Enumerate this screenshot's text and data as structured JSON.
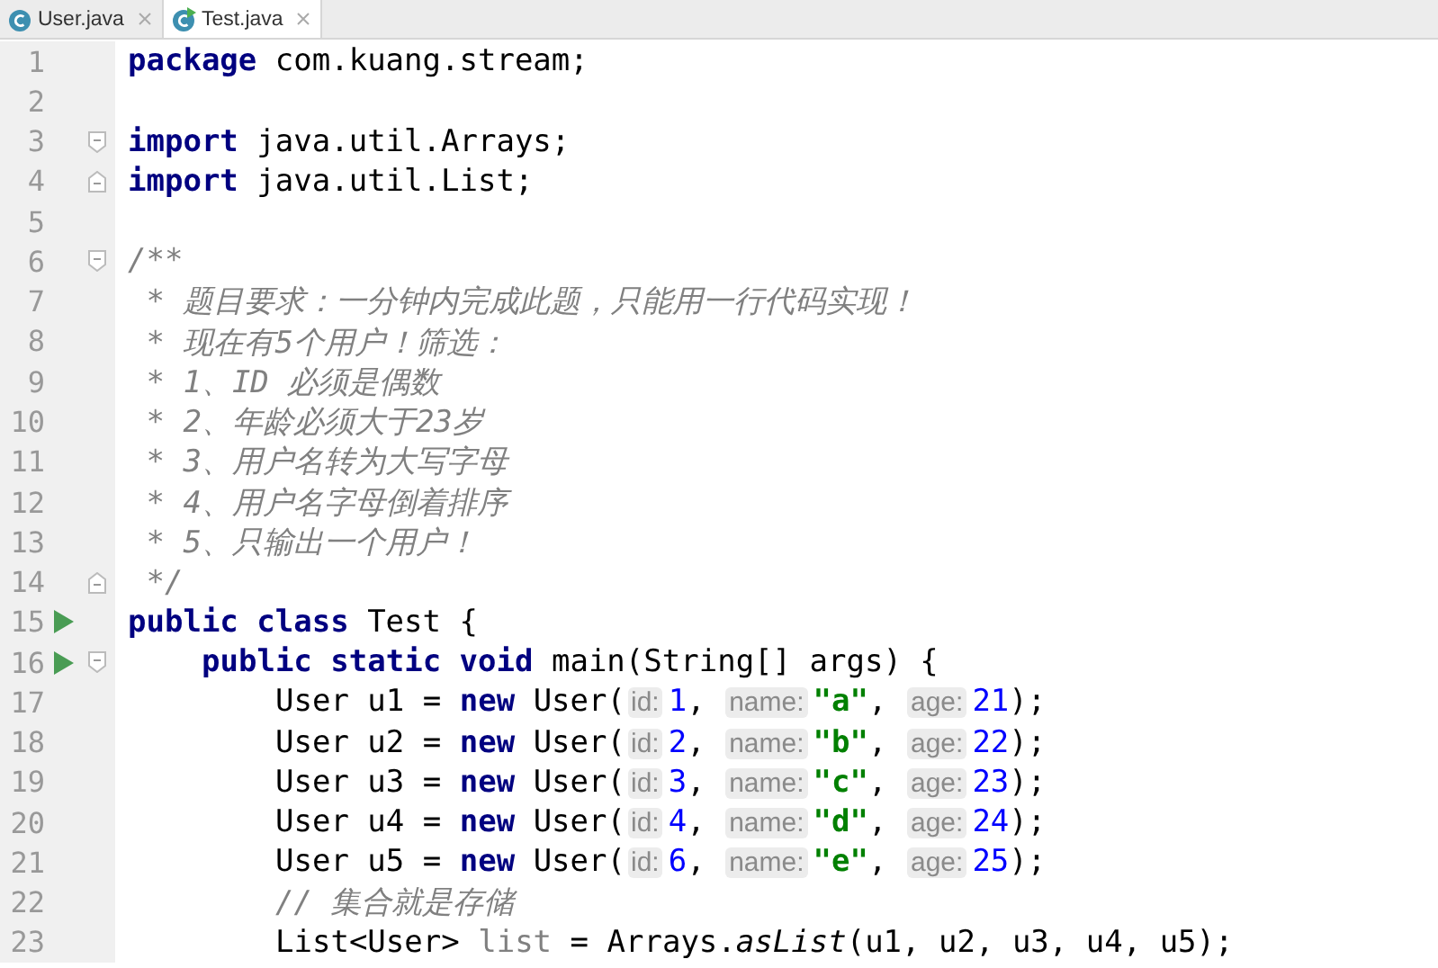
{
  "tabs": [
    {
      "label": "User.java",
      "selected": false,
      "kind": "class"
    },
    {
      "label": "Test.java",
      "selected": true,
      "kind": "runnable"
    }
  ],
  "lines": [
    {
      "number": "1",
      "tokens": [
        {
          "kind": "kw",
          "text": "package"
        },
        {
          "kind": "plain",
          "text": " com.kuang.stream;"
        }
      ]
    },
    {
      "number": "2"
    },
    {
      "number": "3",
      "fold_open": true,
      "tokens": [
        {
          "kind": "kw",
          "text": "import"
        },
        {
          "kind": "plain",
          "text": " java.util.Arrays;"
        }
      ]
    },
    {
      "number": "4",
      "fold_close": true,
      "tokens": [
        {
          "kind": "kw",
          "text": "import"
        },
        {
          "kind": "plain",
          "text": " java.util.List;"
        }
      ]
    },
    {
      "number": "5"
    },
    {
      "number": "6",
      "fold_open": true,
      "tokens": [
        {
          "kind": "comment",
          "text": "/**"
        }
      ]
    },
    {
      "number": "7",
      "tokens": [
        {
          "kind": "comment",
          "text": " * 题目要求：一分钟内完成此题，只能用一行代码实现！"
        }
      ]
    },
    {
      "number": "8",
      "tokens": [
        {
          "kind": "comment",
          "text": " * 现在有5个用户！筛选："
        }
      ]
    },
    {
      "number": "9",
      "tokens": [
        {
          "kind": "comment",
          "text": " * 1、ID 必须是偶数"
        }
      ]
    },
    {
      "number": "10",
      "tokens": [
        {
          "kind": "comment",
          "text": " * 2、年龄必须大于23岁"
        }
      ]
    },
    {
      "number": "11",
      "tokens": [
        {
          "kind": "comment",
          "text": " * 3、用户名转为大写字母"
        }
      ]
    },
    {
      "number": "12",
      "tokens": [
        {
          "kind": "comment",
          "text": " * 4、用户名字母倒着排序"
        }
      ]
    },
    {
      "number": "13",
      "tokens": [
        {
          "kind": "comment",
          "text": " * 5、只输出一个用户！"
        }
      ]
    },
    {
      "number": "14",
      "fold_close": true,
      "tokens": [
        {
          "kind": "comment",
          "text": " */"
        }
      ]
    },
    {
      "number": "15",
      "run": true,
      "tokens": [
        {
          "kind": "kw",
          "text": "public class"
        },
        {
          "kind": "plain",
          "text": " Test {"
        }
      ],
      "children": [
        {
          "number": "16",
          "run": true,
          "fold_open": true,
          "tokens": [
            {
              "kind": "kw",
              "text": "public static void"
            },
            {
              "kind": "plain",
              "text": " main(String[] args) {"
            }
          ],
          "children": [
            {
              "number": "17",
              "tokens": [
                {
                  "kind": "plain",
                  "text": "User u1 = "
                },
                {
                  "kind": "kw",
                  "text": "new"
                },
                {
                  "kind": "plain",
                  "text": " User("
                },
                {
                  "kind": "hint",
                  "text": "id:"
                },
                {
                  "kind": "num",
                  "text": "1"
                },
                {
                  "kind": "plain",
                  "text": ", "
                },
                {
                  "kind": "hint",
                  "text": "name:"
                },
                {
                  "kind": "str",
                  "text": "\"a\""
                },
                {
                  "kind": "plain",
                  "text": ", "
                },
                {
                  "kind": "hint",
                  "text": "age:"
                },
                {
                  "kind": "num",
                  "text": "21"
                },
                {
                  "kind": "plain",
                  "text": ");"
                }
              ]
            },
            {
              "number": "18",
              "tokens": [
                {
                  "kind": "plain",
                  "text": "User u2 = "
                },
                {
                  "kind": "kw",
                  "text": "new"
                },
                {
                  "kind": "plain",
                  "text": " User("
                },
                {
                  "kind": "hint",
                  "text": "id:"
                },
                {
                  "kind": "num",
                  "text": "2"
                },
                {
                  "kind": "plain",
                  "text": ", "
                },
                {
                  "kind": "hint",
                  "text": "name:"
                },
                {
                  "kind": "str",
                  "text": "\"b\""
                },
                {
                  "kind": "plain",
                  "text": ", "
                },
                {
                  "kind": "hint",
                  "text": "age:"
                },
                {
                  "kind": "num",
                  "text": "22"
                },
                {
                  "kind": "plain",
                  "text": ");"
                }
              ]
            },
            {
              "number": "19",
              "tokens": [
                {
                  "kind": "plain",
                  "text": "User u3 = "
                },
                {
                  "kind": "kw",
                  "text": "new"
                },
                {
                  "kind": "plain",
                  "text": " User("
                },
                {
                  "kind": "hint",
                  "text": "id:"
                },
                {
                  "kind": "num",
                  "text": "3"
                },
                {
                  "kind": "plain",
                  "text": ", "
                },
                {
                  "kind": "hint",
                  "text": "name:"
                },
                {
                  "kind": "str",
                  "text": "\"c\""
                },
                {
                  "kind": "plain",
                  "text": ", "
                },
                {
                  "kind": "hint",
                  "text": "age:"
                },
                {
                  "kind": "num",
                  "text": "23"
                },
                {
                  "kind": "plain",
                  "text": ");"
                }
              ]
            },
            {
              "number": "20",
              "tokens": [
                {
                  "kind": "plain",
                  "text": "User u4 = "
                },
                {
                  "kind": "kw",
                  "text": "new"
                },
                {
                  "kind": "plain",
                  "text": " User("
                },
                {
                  "kind": "hint",
                  "text": "id:"
                },
                {
                  "kind": "num",
                  "text": "4"
                },
                {
                  "kind": "plain",
                  "text": ", "
                },
                {
                  "kind": "hint",
                  "text": "name:"
                },
                {
                  "kind": "str",
                  "text": "\"d\""
                },
                {
                  "kind": "plain",
                  "text": ", "
                },
                {
                  "kind": "hint",
                  "text": "age:"
                },
                {
                  "kind": "num",
                  "text": "24"
                },
                {
                  "kind": "plain",
                  "text": ");"
                }
              ]
            },
            {
              "number": "21",
              "tokens": [
                {
                  "kind": "plain",
                  "text": "User u5 = "
                },
                {
                  "kind": "kw",
                  "text": "new"
                },
                {
                  "kind": "plain",
                  "text": " User("
                },
                {
                  "kind": "hint",
                  "text": "id:"
                },
                {
                  "kind": "num",
                  "text": "6"
                },
                {
                  "kind": "plain",
                  "text": ", "
                },
                {
                  "kind": "hint",
                  "text": "name:"
                },
                {
                  "kind": "str",
                  "text": "\"e\""
                },
                {
                  "kind": "plain",
                  "text": ", "
                },
                {
                  "kind": "hint",
                  "text": "age:"
                },
                {
                  "kind": "num",
                  "text": "25"
                },
                {
                  "kind": "plain",
                  "text": ");"
                }
              ]
            },
            {
              "number": "22",
              "tokens": [
                {
                  "kind": "comment",
                  "text": "// 集合就是存储"
                }
              ]
            },
            {
              "number": "23",
              "tokens": [
                {
                  "kind": "plain",
                  "text": "List<User> "
                },
                {
                  "kind": "unused",
                  "text": "list"
                },
                {
                  "kind": "plain",
                  "text": " = Arrays."
                },
                {
                  "kind": "static",
                  "text": "asList"
                },
                {
                  "kind": "plain",
                  "text": "(u1, u2, u3, u4, u5);"
                }
              ]
            }
          ]
        }
      ]
    }
  ]
}
